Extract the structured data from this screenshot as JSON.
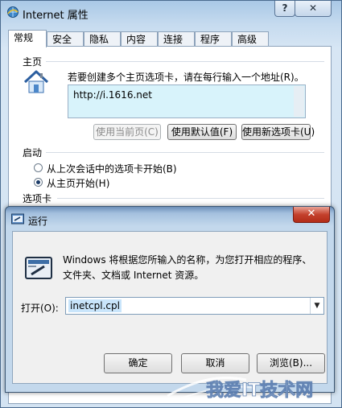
{
  "inet": {
    "title": "Internet 属性",
    "help_label": "?",
    "close_label": "✕",
    "tabs": [
      {
        "label": "常规"
      },
      {
        "label": "安全"
      },
      {
        "label": "隐私"
      },
      {
        "label": "内容"
      },
      {
        "label": "连接"
      },
      {
        "label": "程序"
      },
      {
        "label": "高级"
      }
    ],
    "homepage": {
      "group_title": "主页",
      "instruction": "若要创建多个主页选项卡，请在每行输入一个地址(R)。",
      "url": "http://i.1616.net",
      "btn_current": "使用当前页(C)",
      "btn_default": "使用默认值(F)",
      "btn_new_tab": "使用新选项卡(U)"
    },
    "startup": {
      "group_title": "启动",
      "option_last_session": "从上次会话中的选项卡开始(B)",
      "option_homepage": "从主页开始(H)"
    },
    "tabs_group": {
      "group_title": "选项卡"
    }
  },
  "run": {
    "title": "运行",
    "close_label": "✕",
    "description": "Windows 将根据您所输入的名称，为您打开相应的程序、文件夹、文档或 Internet 资源。",
    "open_label": "打开(O):",
    "input_value": "inetcpl.cpl",
    "btn_ok": "确定",
    "btn_cancel": "取消",
    "btn_browse": "浏览(B)..."
  },
  "watermark": {
    "text": "我爱IT技术网"
  },
  "colors": {
    "accent": "#1b3b68",
    "input_bg": "#d8f3fb",
    "close_red": "#c4412d"
  }
}
